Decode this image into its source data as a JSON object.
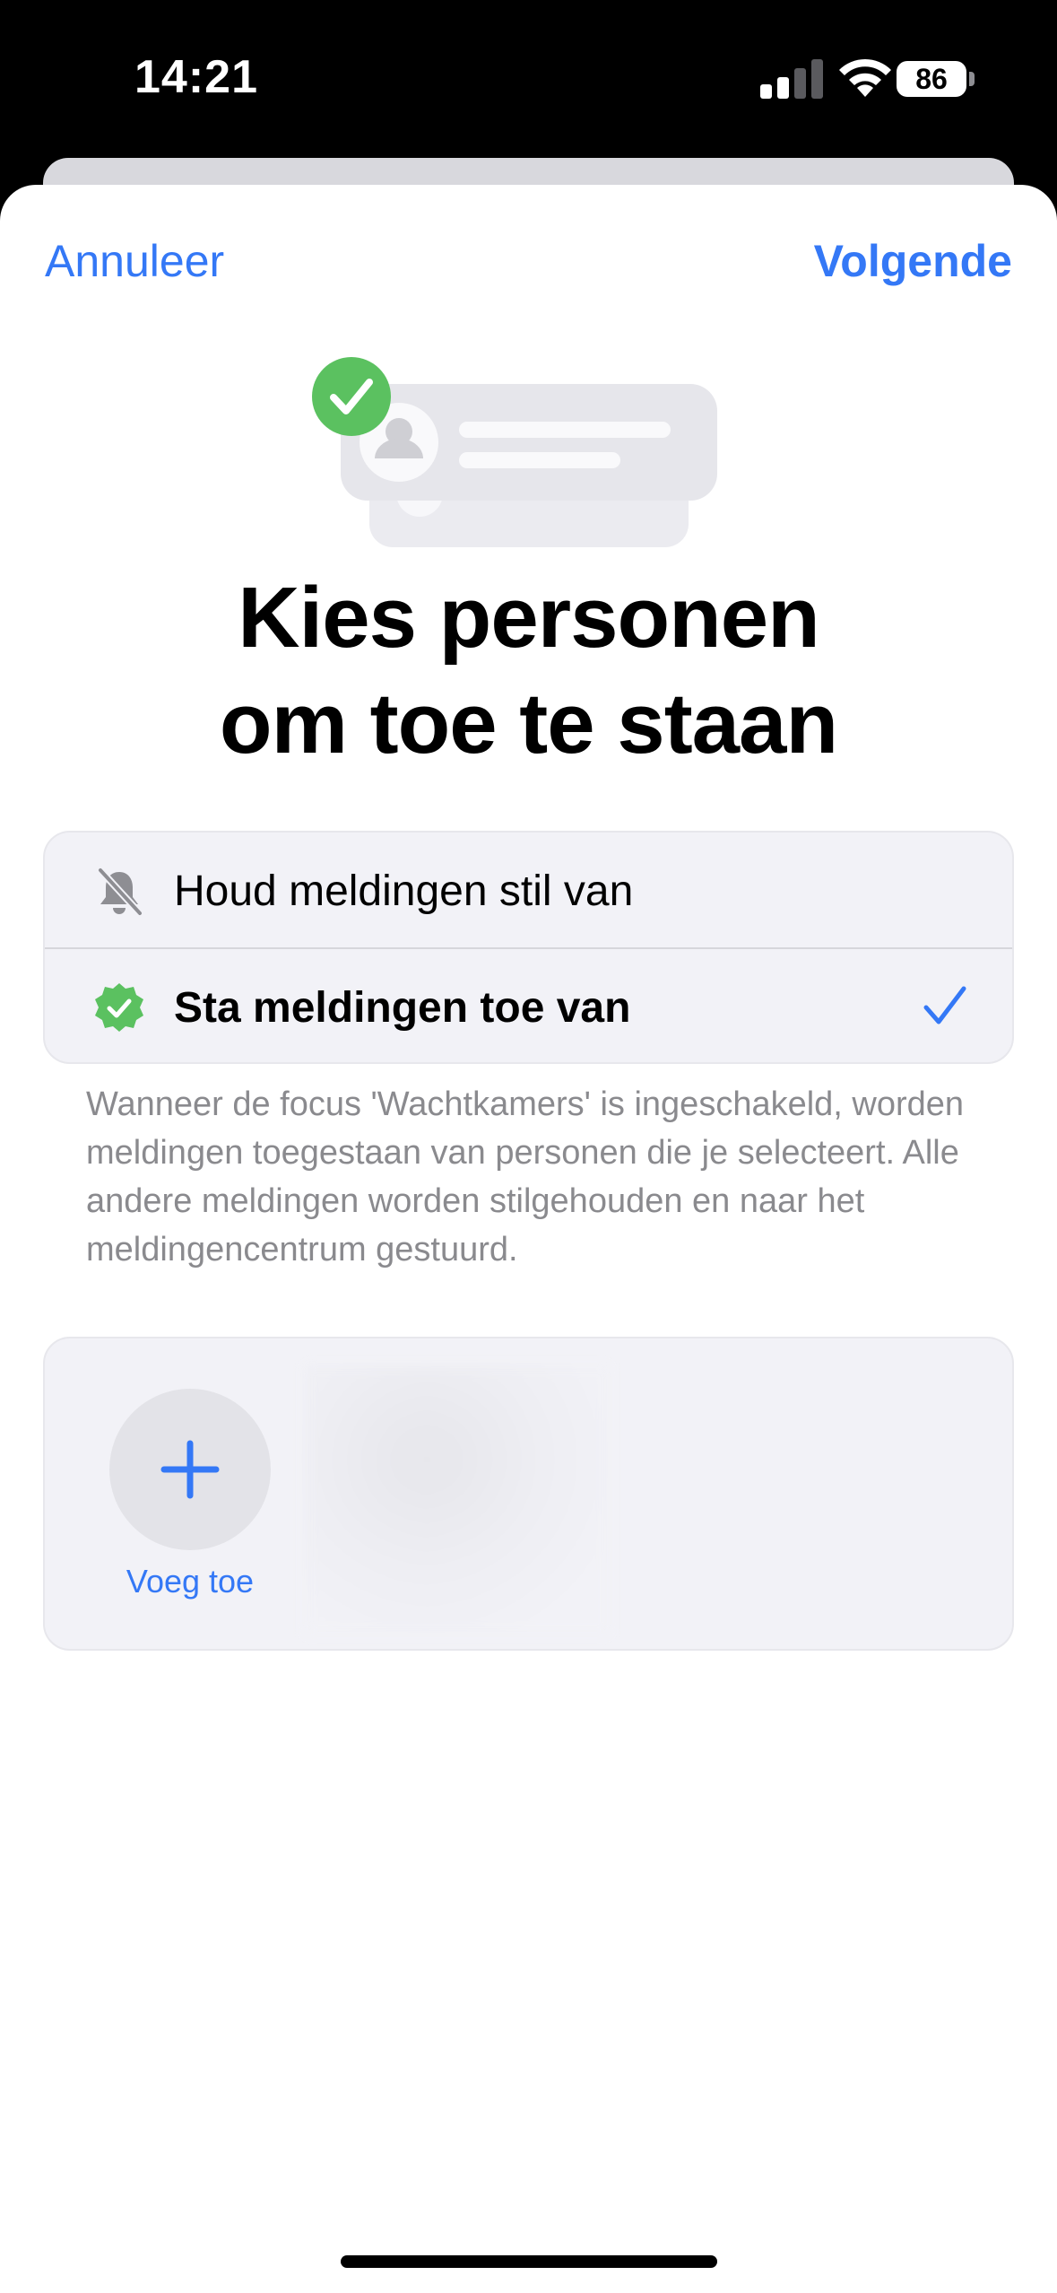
{
  "status_bar": {
    "time": "14:21",
    "battery": "86"
  },
  "nav": {
    "cancel_label": "Annuleer",
    "next_label": "Volgende"
  },
  "title": {
    "line1": "Kies personen",
    "line2": "om toe te staan"
  },
  "options": [
    {
      "label": "Houd meldingen stil van",
      "icon": "bell-slash-icon",
      "selected": false
    },
    {
      "label": "Sta meldingen toe van",
      "icon": "green-check-badge-icon",
      "selected": true
    }
  ],
  "footnote": "Wanneer de focus 'Wachtkamers' is ingeschakeld, worden meldingen toegestaan van personen die je selecteert. Alle andere meldingen worden stilgehouden en naar het meldingencentrum gestuurd.",
  "people": {
    "add_label": "Voeg toe"
  },
  "colors": {
    "accent": "#3478f6",
    "success": "#5bc160",
    "card_bg": "#f2f2f7",
    "secondary_text": "#8a8a8e"
  }
}
